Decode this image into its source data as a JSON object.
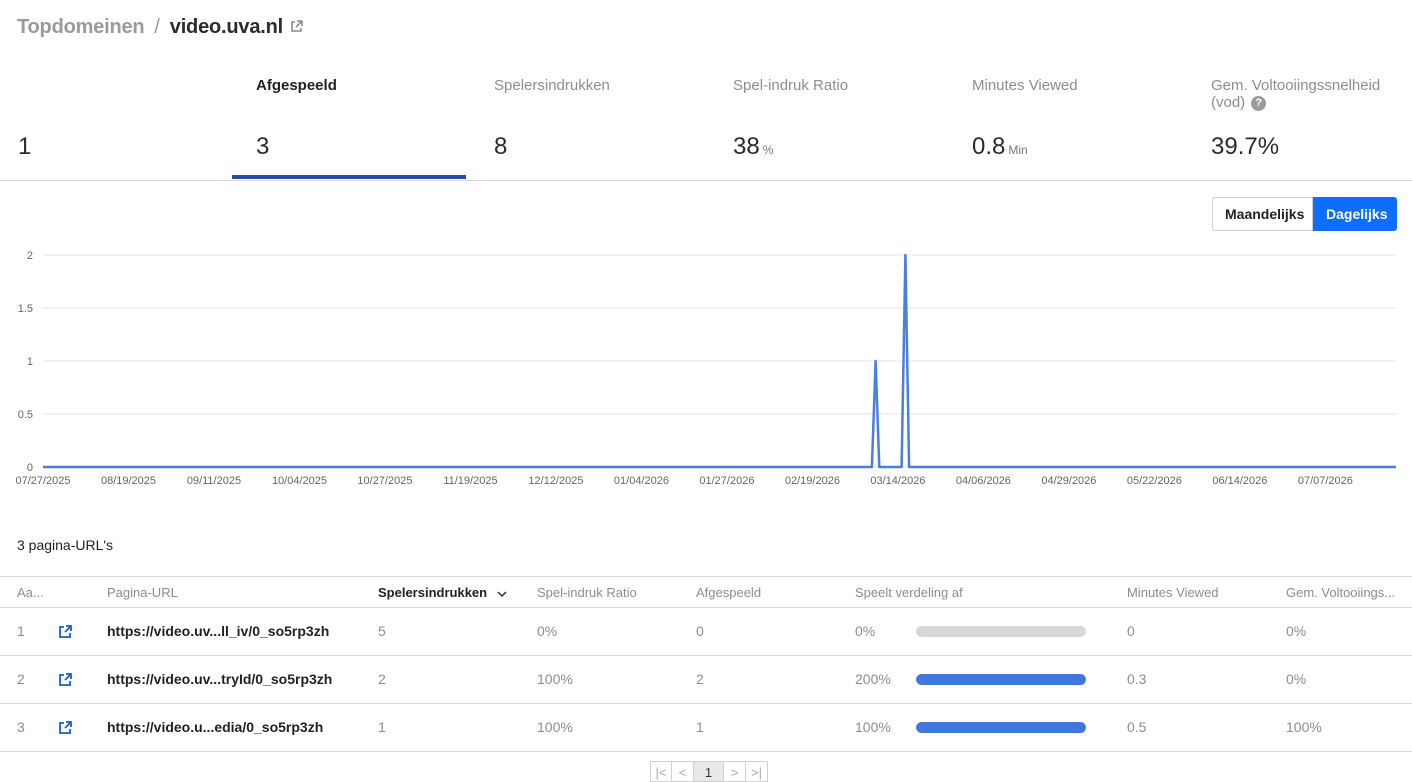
{
  "breadcrumb": {
    "parent": "Topdomeinen",
    "separator": "/",
    "current": "video.uva.nl",
    "link_icon": "external-link-icon"
  },
  "metrics": [
    {
      "label": "",
      "value": "1",
      "unit": ""
    },
    {
      "label": "Afgespeeld",
      "value": "3",
      "unit": "",
      "active": true
    },
    {
      "label": "Spelersindrukken",
      "value": "8",
      "unit": ""
    },
    {
      "label": "Spel-indruk Ratio",
      "value": "38",
      "unit": "%"
    },
    {
      "label": "Minutes Viewed",
      "value": "0.8",
      "unit": "Min"
    },
    {
      "label": "Gem. Voltooiingssnelheid (vod)",
      "value": "39.7%",
      "unit": "",
      "help_icon": "question-circle-icon"
    }
  ],
  "toggle": {
    "monthly": "Maandelijks",
    "daily": "Dagelijks",
    "selected": "daily"
  },
  "chart_data": {
    "type": "line",
    "series": [
      {
        "values": [
          {
            "x": "07/27/2025",
            "y": 0
          },
          {
            "x": "03/07/2026",
            "y": 0
          },
          {
            "x": "03/08/2026",
            "y": 1
          },
          {
            "x": "03/09/2026",
            "y": 0
          },
          {
            "x": "03/15/2026",
            "y": 0
          },
          {
            "x": "03/16/2026",
            "y": 2
          },
          {
            "x": "03/17/2026",
            "y": 0
          },
          {
            "x": "07/26/2026",
            "y": 0
          }
        ]
      }
    ],
    "x_ticks": [
      "07/27/2025",
      "08/19/2025",
      "09/11/2025",
      "10/04/2025",
      "10/27/2025",
      "11/19/2025",
      "12/12/2025",
      "01/04/2026",
      "01/27/2026",
      "02/19/2026",
      "03/14/2026",
      "04/06/2026",
      "04/29/2026",
      "05/22/2026",
      "06/14/2026",
      "07/07/2026"
    ],
    "y_ticks": [
      "0",
      "0.5",
      "1",
      "1.5",
      "2"
    ],
    "ylim": [
      0,
      2
    ],
    "xlim": [
      "07/27/2025",
      "07/26/2026"
    ],
    "grid": true,
    "color": "#4a7ee0"
  },
  "table": {
    "count_label": "3 pagina-URL's",
    "columns": [
      "Aa...",
      "Pagina-URL",
      "Spelersindrukken",
      "Spel-indruk Ratio",
      "Afgespeeld",
      "Speelt verdeling af",
      "Minutes Viewed",
      "Gem. Voltooiings..."
    ],
    "sort_icon": "chevron-down-icon",
    "rows": [
      {
        "index": "1",
        "url": "https://video.uv...ll_iv/0_so5rp3zh",
        "impressions": "5",
        "ratio": "0%",
        "plays": "0",
        "distribution": "0%",
        "distribution_fraction": 0,
        "minutes": "0",
        "completion": "0%"
      },
      {
        "index": "2",
        "url": "https://video.uv...tryId/0_so5rp3zh",
        "impressions": "2",
        "ratio": "100%",
        "plays": "2",
        "distribution": "200%",
        "distribution_fraction": 1,
        "minutes": "0.3",
        "completion": "0%"
      },
      {
        "index": "3",
        "url": "https://video.u...edia/0_so5rp3zh",
        "impressions": "1",
        "ratio": "100%",
        "plays": "1",
        "distribution": "100%",
        "distribution_fraction": 1,
        "minutes": "0.5",
        "completion": "100%"
      }
    ]
  },
  "pagination": {
    "first": "|<",
    "prev": "<",
    "current": "1",
    "next": ">",
    "last": ">|"
  }
}
